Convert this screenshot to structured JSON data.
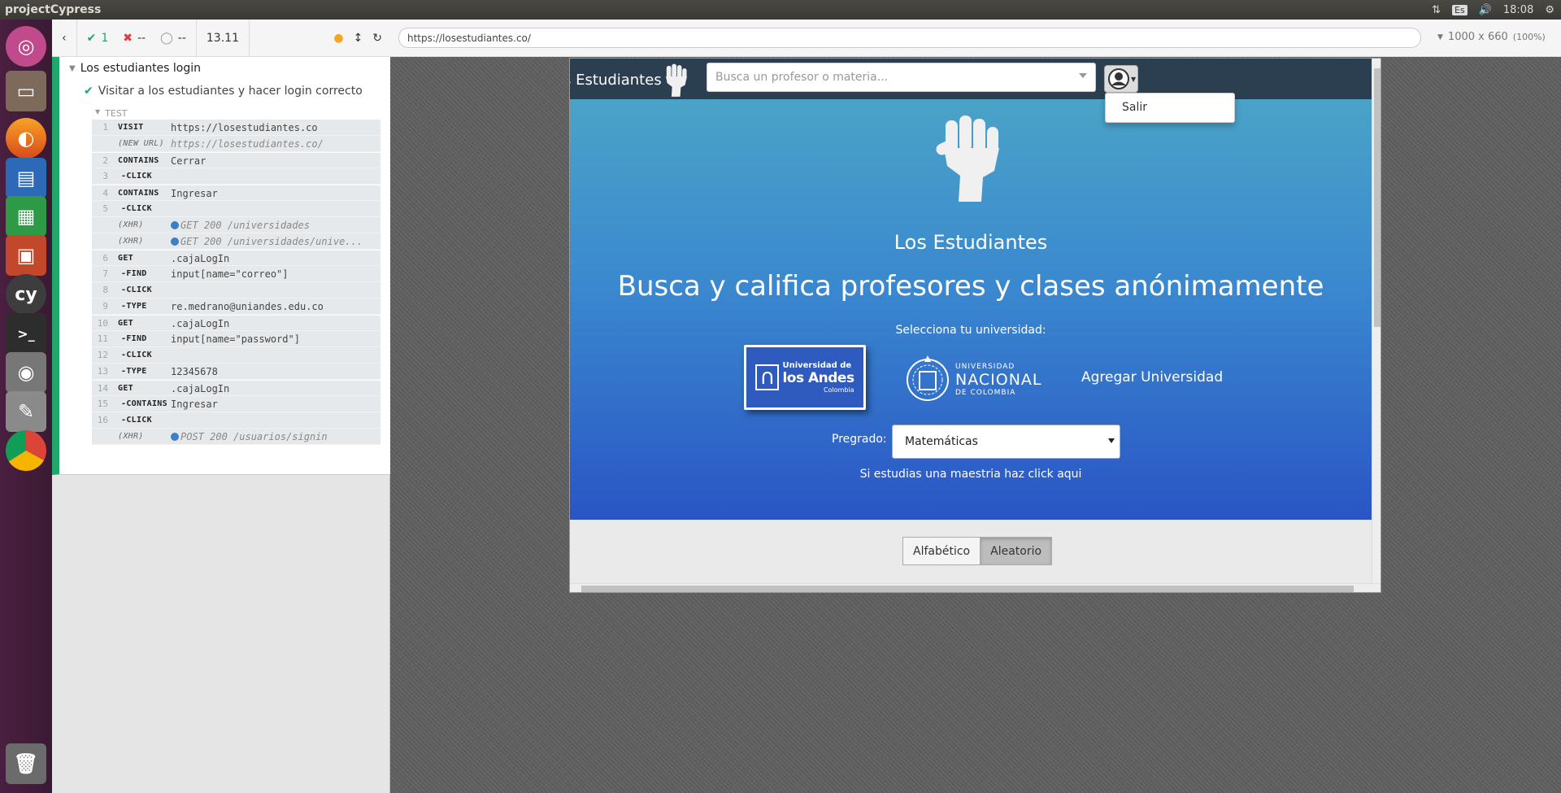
{
  "topbar": {
    "app_name": "projectCypress",
    "keyboard": "Es",
    "time": "18:08"
  },
  "launcher": {
    "items": [
      "ubuntu-dash",
      "files",
      "firefox",
      "writer",
      "calc",
      "impress",
      "cypress",
      "terminal",
      "screenshot",
      "text-editor",
      "chrome",
      "trash"
    ],
    "cypress_label": "cy"
  },
  "runner": {
    "passed_count": "1",
    "failed_count": "--",
    "pending_count": "--",
    "duration": "13.11",
    "suite_title": "Los estudiantes login",
    "test_title": "Visitar a los estudiantes y hacer login correcto",
    "section_label": "TEST",
    "commands": [
      {
        "num": "1",
        "name": "VISIT",
        "msg": "https://losestudiantes.co",
        "style": "cmd"
      },
      {
        "num": "",
        "name": "(NEW URL)",
        "msg": "https://losestudiantes.co/",
        "style": "event"
      },
      {
        "num": "2",
        "name": "CONTAINS",
        "msg": "Cerrar",
        "style": "cmd"
      },
      {
        "num": "3",
        "name": "-CLICK",
        "msg": "",
        "style": "child"
      },
      {
        "num": "4",
        "name": "CONTAINS",
        "msg": "Ingresar",
        "style": "cmd"
      },
      {
        "num": "5",
        "name": "-CLICK",
        "msg": "",
        "style": "child"
      },
      {
        "num": "",
        "name": "(XHR)",
        "msg": "GET 200 /universidades",
        "style": "xhr"
      },
      {
        "num": "",
        "name": "(XHR)",
        "msg": "GET 200 /universidades/unive...",
        "style": "xhr"
      },
      {
        "num": "6",
        "name": "GET",
        "msg": ".cajaLogIn",
        "style": "cmd"
      },
      {
        "num": "7",
        "name": "-FIND",
        "msg": "input[name=\"correo\"]",
        "style": "child"
      },
      {
        "num": "8",
        "name": "-CLICK",
        "msg": "",
        "style": "child"
      },
      {
        "num": "9",
        "name": "-TYPE",
        "msg": "re.medrano@uniandes.edu.co",
        "style": "child"
      },
      {
        "num": "10",
        "name": "GET",
        "msg": ".cajaLogIn",
        "style": "cmd"
      },
      {
        "num": "11",
        "name": "-FIND",
        "msg": "input[name=\"password\"]",
        "style": "child"
      },
      {
        "num": "12",
        "name": "-CLICK",
        "msg": "",
        "style": "child"
      },
      {
        "num": "13",
        "name": "-TYPE",
        "msg": "12345678",
        "style": "child"
      },
      {
        "num": "14",
        "name": "GET",
        "msg": ".cajaLogIn",
        "style": "cmd"
      },
      {
        "num": "15",
        "name": "-CONTAINS",
        "msg": "Ingresar",
        "style": "child"
      },
      {
        "num": "16",
        "name": "-CLICK",
        "msg": "",
        "style": "child"
      },
      {
        "num": "",
        "name": "(XHR)",
        "msg": "POST 200 /usuarios/signin",
        "style": "xhr"
      }
    ]
  },
  "urlbar": {
    "url": "https://losestudiantes.co/",
    "viewport": "1000 x 660",
    "scale": "(100%)"
  },
  "app": {
    "brand": "s Estudiantes",
    "search_placeholder": "Busca un profesor o materia...",
    "dropdown_item": "Salir",
    "site_name": "Los Estudiantes",
    "headline": "Busca y califica profesores y clases anónimamente",
    "select_university": "Selecciona tu universidad:",
    "andes": {
      "line1": "Universidad de",
      "line2": "los Andes",
      "line3": "Colombia"
    },
    "nacional": {
      "line1": "UNIVERSIDAD",
      "line2": "NACIONAL",
      "line3": "DE COLOMBIA"
    },
    "add_university": "Agregar Universidad",
    "pregrado_label": "Pregrado:",
    "pregrado_value": "Matemáticas",
    "maestria_link": "Si estudias una maestria haz click aqui",
    "sort_alpha": "Alfabético",
    "sort_random": "Aleatorio"
  },
  "colors": {
    "pass_green": "#1fa86a",
    "fail_red": "#e0393e",
    "xhr_blue": "#3b7fc4",
    "navbar": "#2b3f50",
    "hero_top": "#4aa3c7",
    "hero_bottom": "#2a55c5"
  }
}
